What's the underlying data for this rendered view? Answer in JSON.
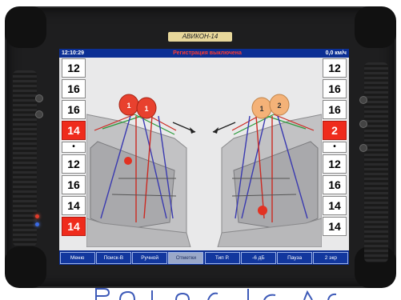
{
  "device": {
    "brand": "АВИКОН-14"
  },
  "status": {
    "clock": "12:10:29",
    "title": "Регистрация выключена",
    "speed": "0,0 км/ч"
  },
  "left_channels": [
    "12",
    "16",
    "16",
    "14",
    "•",
    "12",
    "16",
    "14",
    "14"
  ],
  "right_channels": [
    "12",
    "16",
    "16",
    "2",
    "•",
    "12",
    "16",
    "14",
    "14"
  ],
  "left_alert_index": [
    3,
    8
  ],
  "right_alert_index": [
    3
  ],
  "probes": {
    "left": [
      "1",
      "1"
    ],
    "right": [
      "1",
      "2"
    ]
  },
  "toolbar": [
    "Меню",
    "Поиск-В",
    "Ручной",
    "Отметки",
    "Тип Р.",
    "-6 дБ",
    "Пауза",
    "2 экр"
  ],
  "toolbar_active_index": 3,
  "colors": {
    "screen_header": "#0c2f94",
    "alert": "#ef2b1c",
    "left_probe": "#e8412e",
    "right_probe": "#f4b278",
    "beam_blue": "#3a3ab0",
    "beam_red": "#cc2a22"
  }
}
